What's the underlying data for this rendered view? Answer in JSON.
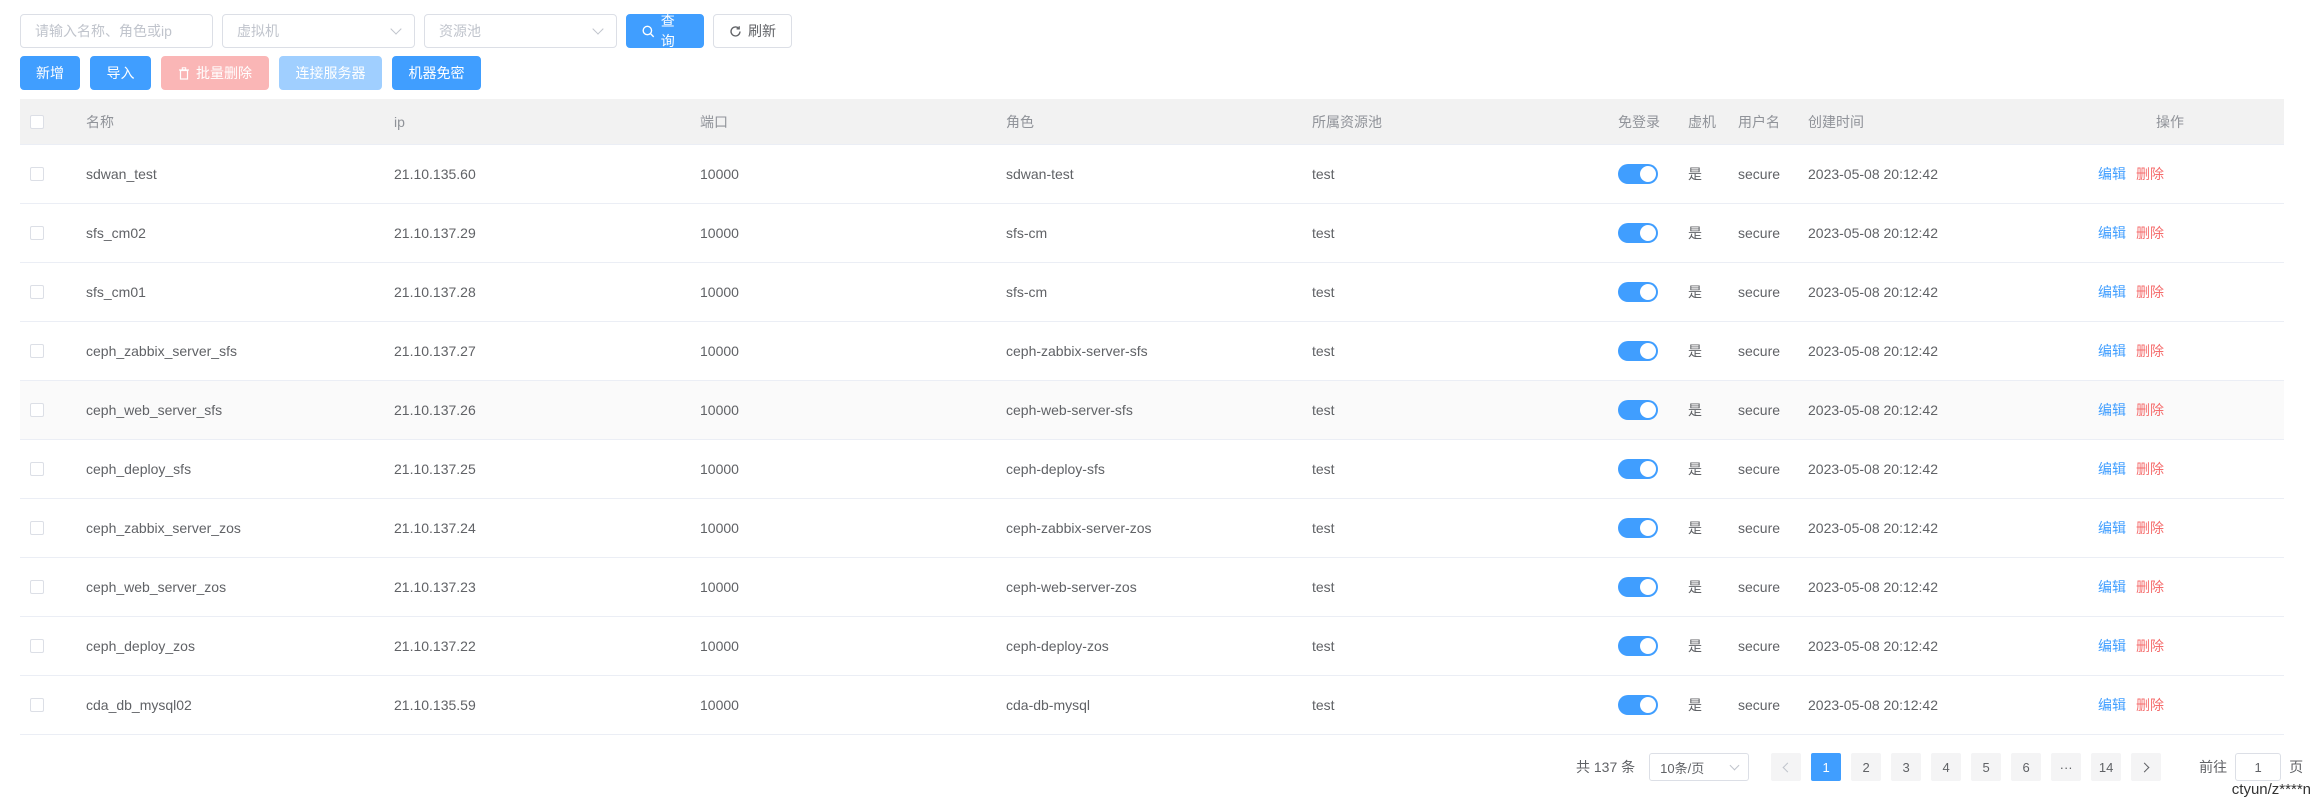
{
  "filters": {
    "keyword_placeholder": "请输入名称、角色或ip",
    "vm_placeholder": "虚拟机",
    "pool_placeholder": "资源池",
    "query_label": "查询",
    "refresh_label": "刷新"
  },
  "actions": {
    "add_label": "新增",
    "import_label": "导入",
    "batch_delete_label": "批量删除",
    "connect_label": "连接服务器",
    "passwordless_label": "机器免密"
  },
  "table": {
    "headers": {
      "name": "名称",
      "ip": "ip",
      "port": "端口",
      "role": "角色",
      "pool": "所属资源池",
      "login": "免登录",
      "vm": "虚机",
      "user": "用户名",
      "time": "创建时间",
      "ops": "操作"
    },
    "edit_label": "编辑",
    "delete_label": "删除",
    "rows": [
      {
        "name": "sdwan_test",
        "ip": "21.10.135.60",
        "port": "10000",
        "role": "sdwan-test",
        "pool": "test",
        "vm": "是",
        "user": "secure",
        "time": "2023-05-08 20:12:42"
      },
      {
        "name": "sfs_cm02",
        "ip": "21.10.137.29",
        "port": "10000",
        "role": "sfs-cm",
        "pool": "test",
        "vm": "是",
        "user": "secure",
        "time": "2023-05-08 20:12:42"
      },
      {
        "name": "sfs_cm01",
        "ip": "21.10.137.28",
        "port": "10000",
        "role": "sfs-cm",
        "pool": "test",
        "vm": "是",
        "user": "secure",
        "time": "2023-05-08 20:12:42"
      },
      {
        "name": "ceph_zabbix_server_sfs",
        "ip": "21.10.137.27",
        "port": "10000",
        "role": "ceph-zabbix-server-sfs",
        "pool": "test",
        "vm": "是",
        "user": "secure",
        "time": "2023-05-08 20:12:42"
      },
      {
        "name": "ceph_web_server_sfs",
        "ip": "21.10.137.26",
        "port": "10000",
        "role": "ceph-web-server-sfs",
        "pool": "test",
        "vm": "是",
        "user": "secure",
        "time": "2023-05-08 20:12:42"
      },
      {
        "name": "ceph_deploy_sfs",
        "ip": "21.10.137.25",
        "port": "10000",
        "role": "ceph-deploy-sfs",
        "pool": "test",
        "vm": "是",
        "user": "secure",
        "time": "2023-05-08 20:12:42"
      },
      {
        "name": "ceph_zabbix_server_zos",
        "ip": "21.10.137.24",
        "port": "10000",
        "role": "ceph-zabbix-server-zos",
        "pool": "test",
        "vm": "是",
        "user": "secure",
        "time": "2023-05-08 20:12:42"
      },
      {
        "name": "ceph_web_server_zos",
        "ip": "21.10.137.23",
        "port": "10000",
        "role": "ceph-web-server-zos",
        "pool": "test",
        "vm": "是",
        "user": "secure",
        "time": "2023-05-08 20:12:42"
      },
      {
        "name": "ceph_deploy_zos",
        "ip": "21.10.137.22",
        "port": "10000",
        "role": "ceph-deploy-zos",
        "pool": "test",
        "vm": "是",
        "user": "secure",
        "time": "2023-05-08 20:12:42"
      },
      {
        "name": "cda_db_mysql02",
        "ip": "21.10.135.59",
        "port": "10000",
        "role": "cda-db-mysql",
        "pool": "test",
        "vm": "是",
        "user": "secure",
        "time": "2023-05-08 20:12:42"
      }
    ]
  },
  "pagination": {
    "total_text": "共 137 条",
    "page_size": "10条/页",
    "pages": [
      "1",
      "2",
      "3",
      "4",
      "5",
      "6"
    ],
    "ellipsis": "···",
    "last_page": "14",
    "current": "1",
    "goto_prefix": "前往",
    "goto_value": "1",
    "goto_suffix": "页"
  },
  "watermark": "ctyun/z****n",
  "colors": {
    "primary": "#409eff",
    "danger": "#f56c6c",
    "danger_disabled": "#fab6b6",
    "primary_disabled": "#a0cfff"
  }
}
